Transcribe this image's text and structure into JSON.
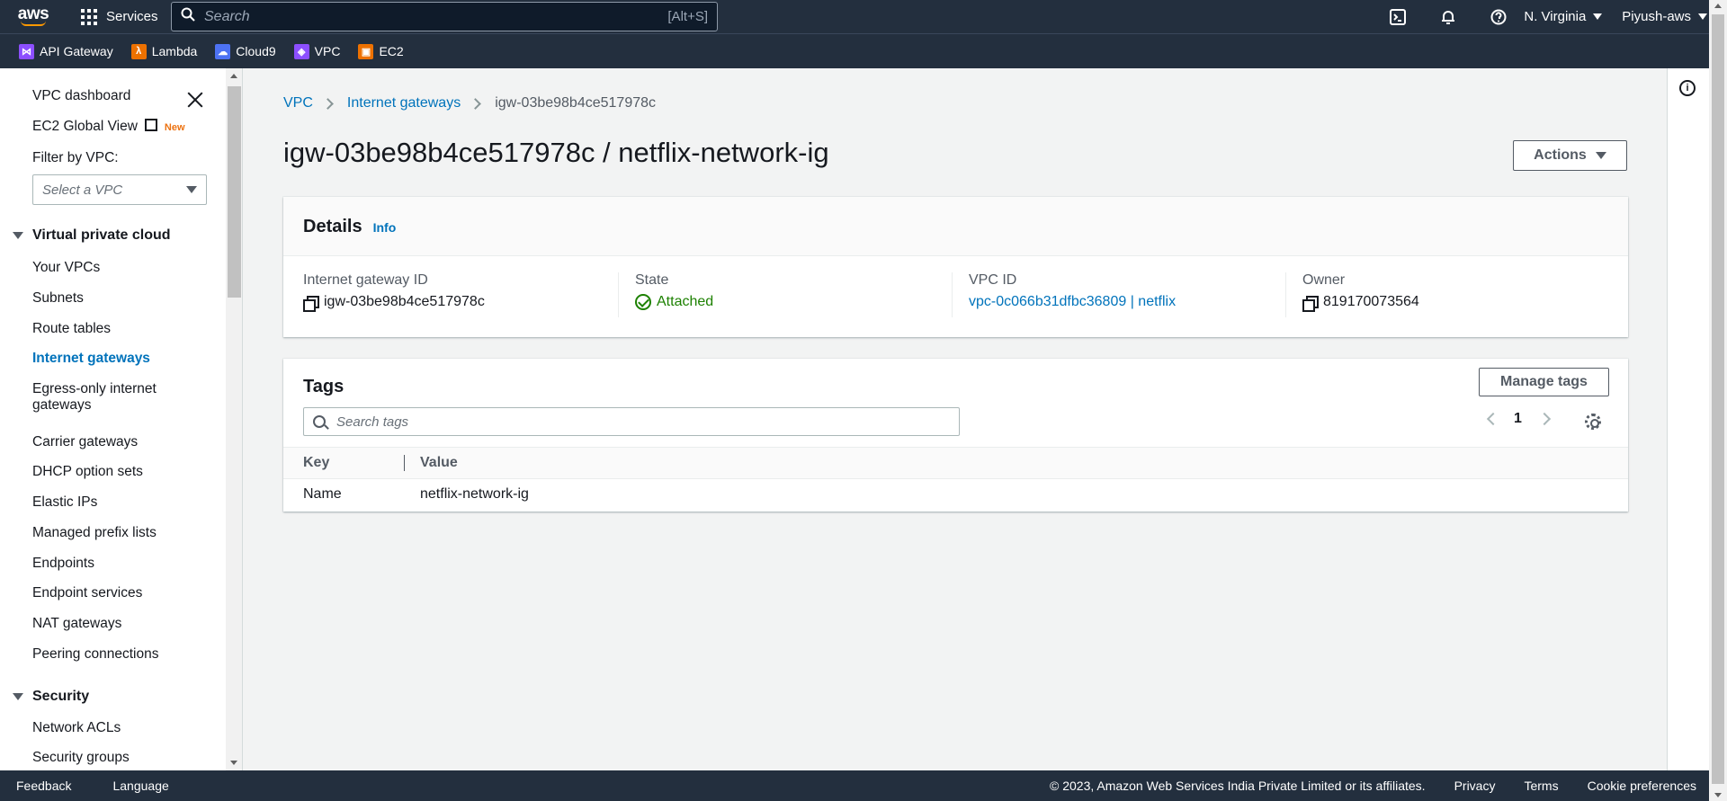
{
  "topnav": {
    "logo": "aws",
    "services_label": "Services",
    "search_placeholder": "Search",
    "search_shortcut": "[Alt+S]",
    "region": "N. Virginia",
    "user": "Piyush-aws",
    "icons": [
      "cloudshell-icon",
      "bell-icon",
      "help-icon"
    ]
  },
  "favorites": [
    {
      "label": "API Gateway",
      "icon": "api-gateway-icon",
      "color": "#8c4fff"
    },
    {
      "label": "Lambda",
      "icon": "lambda-icon",
      "color": "#ed7100"
    },
    {
      "label": "Cloud9",
      "icon": "cloud9-icon",
      "color": "#4d72f3"
    },
    {
      "label": "VPC",
      "icon": "vpc-icon",
      "color": "#8c4fff"
    },
    {
      "label": "EC2",
      "icon": "ec2-icon",
      "color": "#ed7100"
    }
  ],
  "sidebar": {
    "dashboard": "VPC dashboard",
    "global_view": "EC2 Global View",
    "new_badge": "New",
    "filter_label": "Filter by VPC:",
    "filter_placeholder": "Select a VPC",
    "section_vpc": "Virtual private cloud",
    "items": [
      "Your VPCs",
      "Subnets",
      "Route tables",
      "Internet gateways",
      "Egress-only internet",
      "gateways",
      "Carrier gateways",
      "DHCP option sets",
      "Elastic IPs",
      "Managed prefix lists",
      "Endpoints",
      "Endpoint services",
      "NAT gateways",
      "Peering connections"
    ],
    "section_security": "Security",
    "security_items": [
      "Network ACLs",
      "Security groups"
    ]
  },
  "breadcrumb": {
    "items": [
      "VPC",
      "Internet gateways"
    ],
    "current": "igw-03be98b4ce517978c"
  },
  "page": {
    "title": "igw-03be98b4ce517978c / netflix-network-ig",
    "actions_label": "Actions"
  },
  "details": {
    "title": "Details",
    "info": "Info",
    "fields": {
      "igw_label": "Internet gateway ID",
      "igw_value": "igw-03be98b4ce517978c",
      "state_label": "State",
      "state_value": "Attached",
      "vpc_label": "VPC ID",
      "vpc_value": "vpc-0c066b31dfbc36809 | netflix",
      "owner_label": "Owner",
      "owner_value": "819170073564"
    }
  },
  "tags": {
    "title": "Tags",
    "manage_label": "Manage tags",
    "search_placeholder": "Search tags",
    "page": "1",
    "columns": [
      "Key",
      "Value"
    ],
    "rows": [
      {
        "key": "Name",
        "value": "netflix-network-ig"
      }
    ]
  },
  "footer": {
    "feedback": "Feedback",
    "language": "Language",
    "copyright": "© 2023, Amazon Web Services India Private Limited or its affiliates.",
    "privacy": "Privacy",
    "terms": "Terms",
    "cookies": "Cookie preferences"
  }
}
